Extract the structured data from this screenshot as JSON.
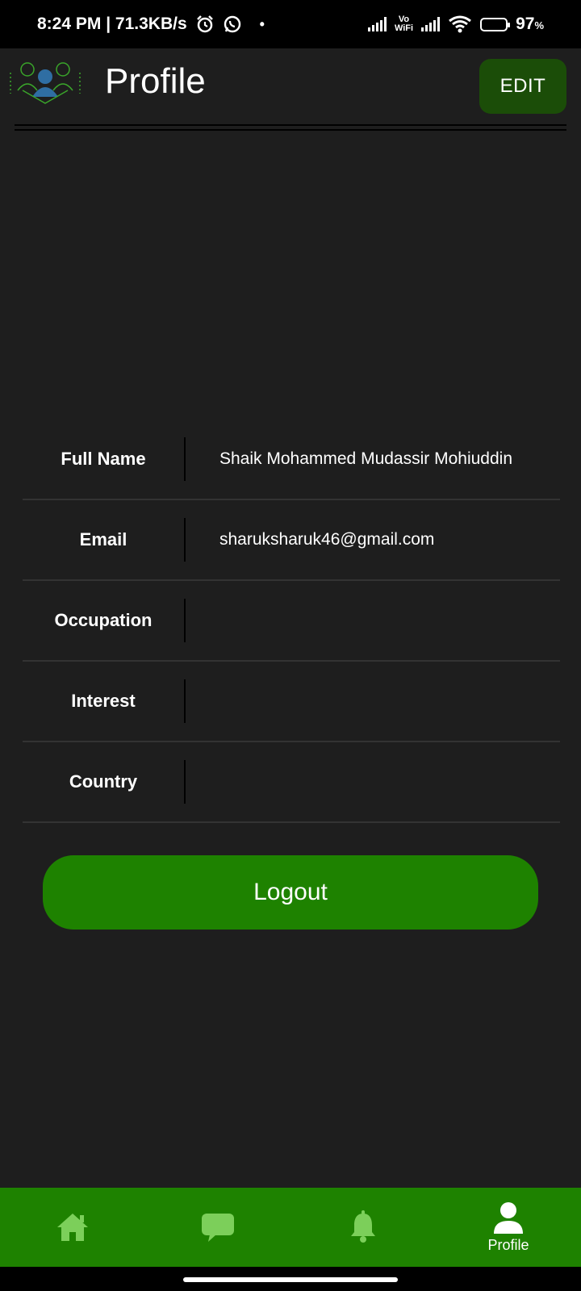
{
  "status_bar": {
    "time_speed": "8:24 PM | 71.3KB/s",
    "vowifi_top": "Vo",
    "vowifi_bottom": "WiFi",
    "battery": "97",
    "battery_unit": "%"
  },
  "app_bar": {
    "title": "Profile",
    "edit_label": "EDIT",
    "logo_icon": "people-group-logo"
  },
  "profile": {
    "rows": [
      {
        "label": "Full Name",
        "value": "Shaik Mohammed Mudassir Mohiuddin"
      },
      {
        "label": "Email",
        "value": "sharuksharuk46@gmail.com"
      },
      {
        "label": "Occupation",
        "value": ""
      },
      {
        "label": "Interest",
        "value": ""
      },
      {
        "label": "Country",
        "value": ""
      }
    ]
  },
  "logout_label": "Logout",
  "bottom_nav": {
    "items": [
      {
        "icon": "home-icon",
        "label": ""
      },
      {
        "icon": "chat-icon",
        "label": ""
      },
      {
        "icon": "bell-icon",
        "label": ""
      },
      {
        "icon": "person-icon",
        "label": "Profile"
      }
    ]
  },
  "colors": {
    "background": "#1e1e1e",
    "accent_green": "#1e8200",
    "edit_green": "#1b4d08",
    "inactive_icon": "#7ccf5a"
  }
}
